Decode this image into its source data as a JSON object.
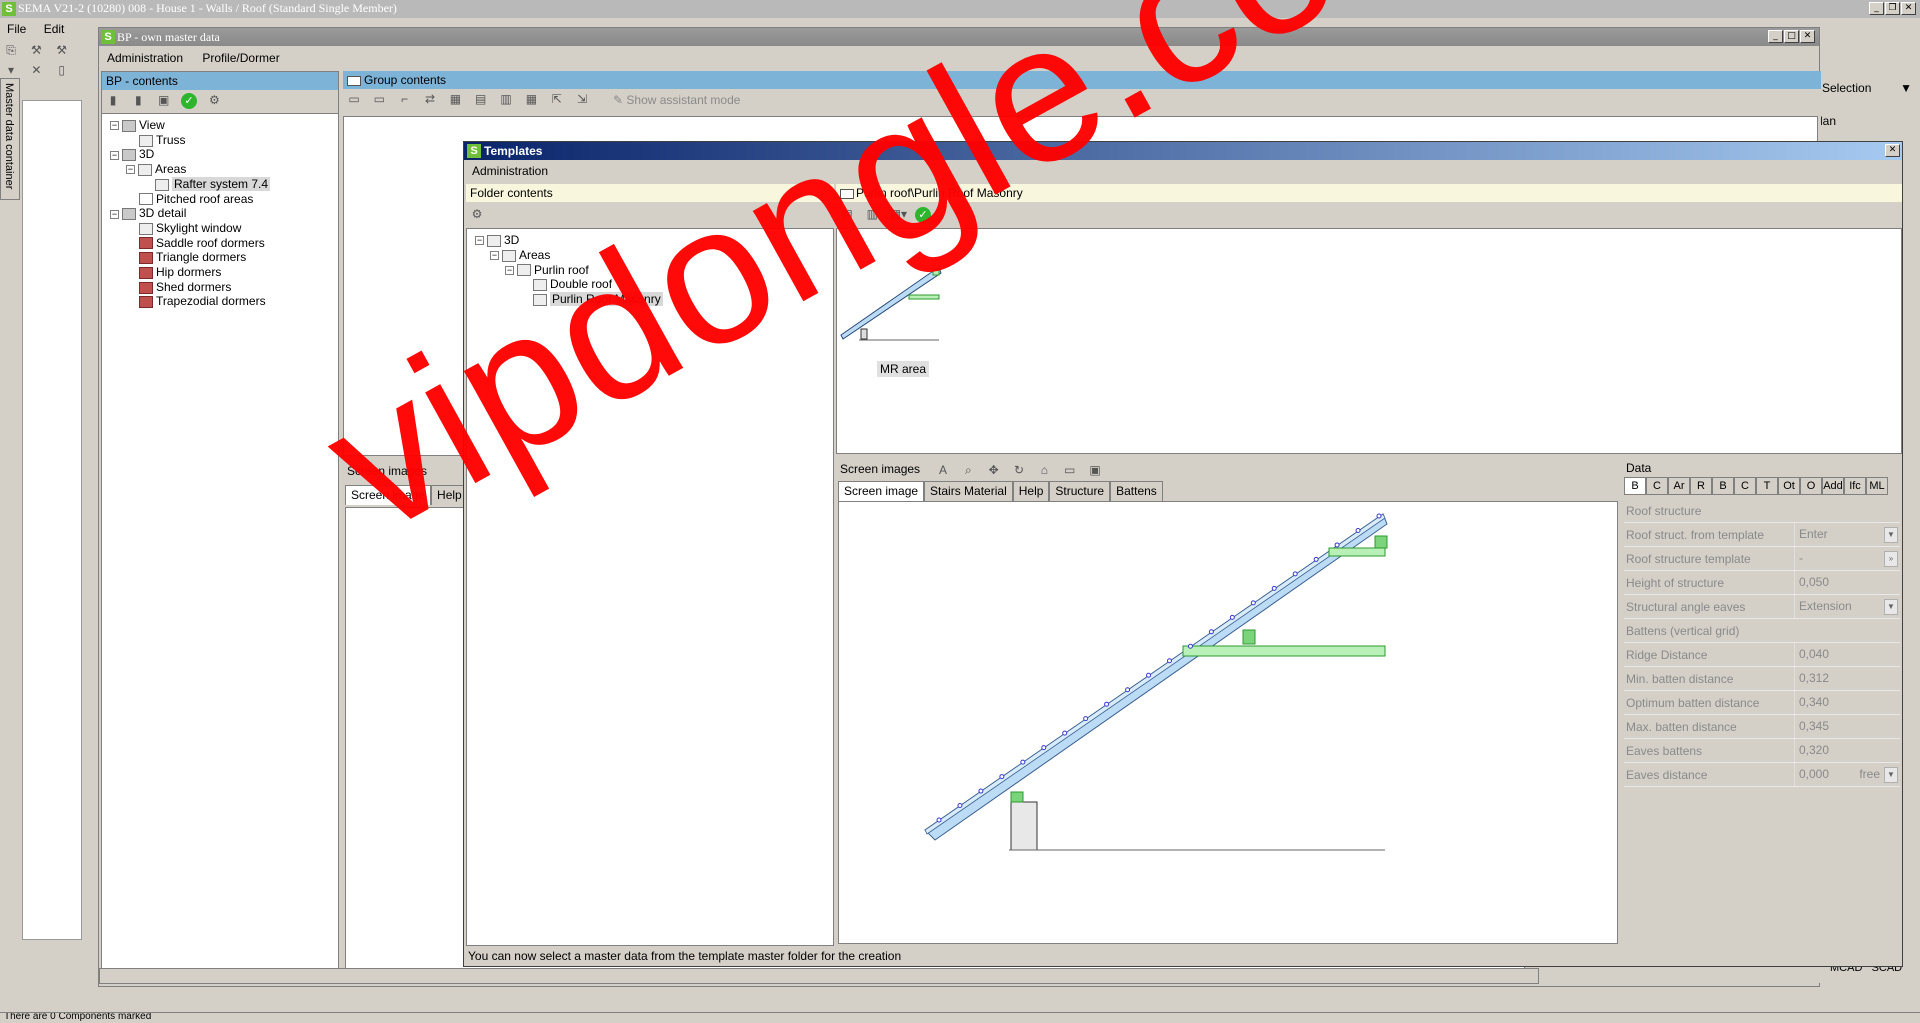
{
  "app": {
    "title": "SEMA V21-2 (10280) 008 - House 1  - Walls / Roof (Standard Single Member)",
    "menu": [
      "File",
      "Edit"
    ],
    "master_tab_label": "Master data container",
    "status_text": "There are 0 Components marked"
  },
  "bp_window": {
    "title": "BP - own master data",
    "menu": [
      "Administration",
      "Profile/Dormer"
    ],
    "contents_header": "BP - contents",
    "tree": [
      {
        "label": "View",
        "level": 0,
        "toggle": "−",
        "icon": "db"
      },
      {
        "label": "Truss",
        "level": 1,
        "toggle": "",
        "icon": "truss"
      },
      {
        "label": "3D",
        "level": 0,
        "toggle": "−",
        "icon": "db"
      },
      {
        "label": "Areas",
        "level": 1,
        "toggle": "−",
        "icon": "folder"
      },
      {
        "label": "Rafter system 7.4",
        "level": 2,
        "toggle": "",
        "icon": "folder",
        "selected": true
      },
      {
        "label": "Pitched roof areas",
        "level": 1,
        "toggle": "",
        "icon": "flat"
      },
      {
        "label": "3D detail",
        "level": 0,
        "toggle": "−",
        "icon": "db"
      },
      {
        "label": "Skylight window",
        "level": 1,
        "toggle": "",
        "icon": "window"
      },
      {
        "label": "Saddle roof dormers",
        "level": 1,
        "toggle": "",
        "icon": "dormer"
      },
      {
        "label": "Triangle dormers",
        "level": 1,
        "toggle": "",
        "icon": "dormer"
      },
      {
        "label": "Hip dormers",
        "level": 1,
        "toggle": "",
        "icon": "dormer"
      },
      {
        "label": "Shed dormers",
        "level": 1,
        "toggle": "",
        "icon": "dormer"
      },
      {
        "label": "Trapezodial dormers",
        "level": 1,
        "toggle": "",
        "icon": "dormer"
      }
    ],
    "group_header": "Group contents",
    "assistant_label": "Show assistant mode",
    "screen_images_label": "Screen images",
    "screen_tabs": [
      "Screen image",
      "Help"
    ]
  },
  "templates_window": {
    "title": "Templates",
    "menu": [
      "Administration"
    ],
    "folder_header": "Folder contents",
    "tree": [
      {
        "label": "3D",
        "level": 0,
        "toggle": "−"
      },
      {
        "label": "Areas",
        "level": 1,
        "toggle": "−"
      },
      {
        "label": "Purlin roof",
        "level": 2,
        "toggle": "−"
      },
      {
        "label": "Double roof",
        "level": 3,
        "toggle": ""
      },
      {
        "label": "Purlin Roof Masonry",
        "level": 3,
        "toggle": "",
        "selected": true
      }
    ],
    "content_header": "Purlin roof\\Purlin Roof Masonry",
    "preview_item_label": "MR area",
    "screen_images_label": "Screen images",
    "screen_tabs": [
      "Screen image",
      "Stairs Material",
      "Help",
      "Structure",
      "Battens"
    ],
    "data": {
      "header": "Data",
      "tabs": [
        "B",
        "C",
        "Ar",
        "R",
        "B",
        "C",
        "T",
        "Ot",
        "O",
        "Add",
        "Ifc",
        "ML"
      ],
      "rows": [
        {
          "label": "Roof structure",
          "value": "",
          "section": true
        },
        {
          "label": "Roof struct. from template",
          "value": "Enter",
          "control": "dropdown"
        },
        {
          "label": "Roof structure template",
          "value": "-",
          "control": "more"
        },
        {
          "label": "Height of structure",
          "value": "0,050"
        },
        {
          "label": "Structural angle eaves",
          "value": "Extension",
          "control": "dropdown"
        },
        {
          "label": "Battens (vertical grid)",
          "value": "",
          "section": true
        },
        {
          "label": "Ridge Distance",
          "value": "0,040"
        },
        {
          "label": "Min. batten distance",
          "value": "0,312"
        },
        {
          "label": "Optimum batten distance",
          "value": "0,340"
        },
        {
          "label": "Max. batten distance",
          "value": "0,345"
        },
        {
          "label": "Eaves battens",
          "value": "0,320"
        },
        {
          "label": "Eaves distance",
          "value": "0,000",
          "suffix": "free",
          "control": "dropdown"
        }
      ]
    },
    "status": "You can now select a master data from the template master folder for the creation"
  },
  "right_strip": {
    "selection_label": "Selection",
    "plan_label": "lan",
    "mcad_label": "MCAD",
    "scad_label": "SCAD"
  },
  "watermark": "vipdongle.com",
  "colors": {
    "panel_header_blue": "#7eb3d8",
    "template_title_start": "#0a246a",
    "template_title_end": "#a6caf0",
    "beam_blue": "#bcdcf5",
    "purlin_green": "#b8f0b8",
    "watermark_red": "#ff0000"
  }
}
